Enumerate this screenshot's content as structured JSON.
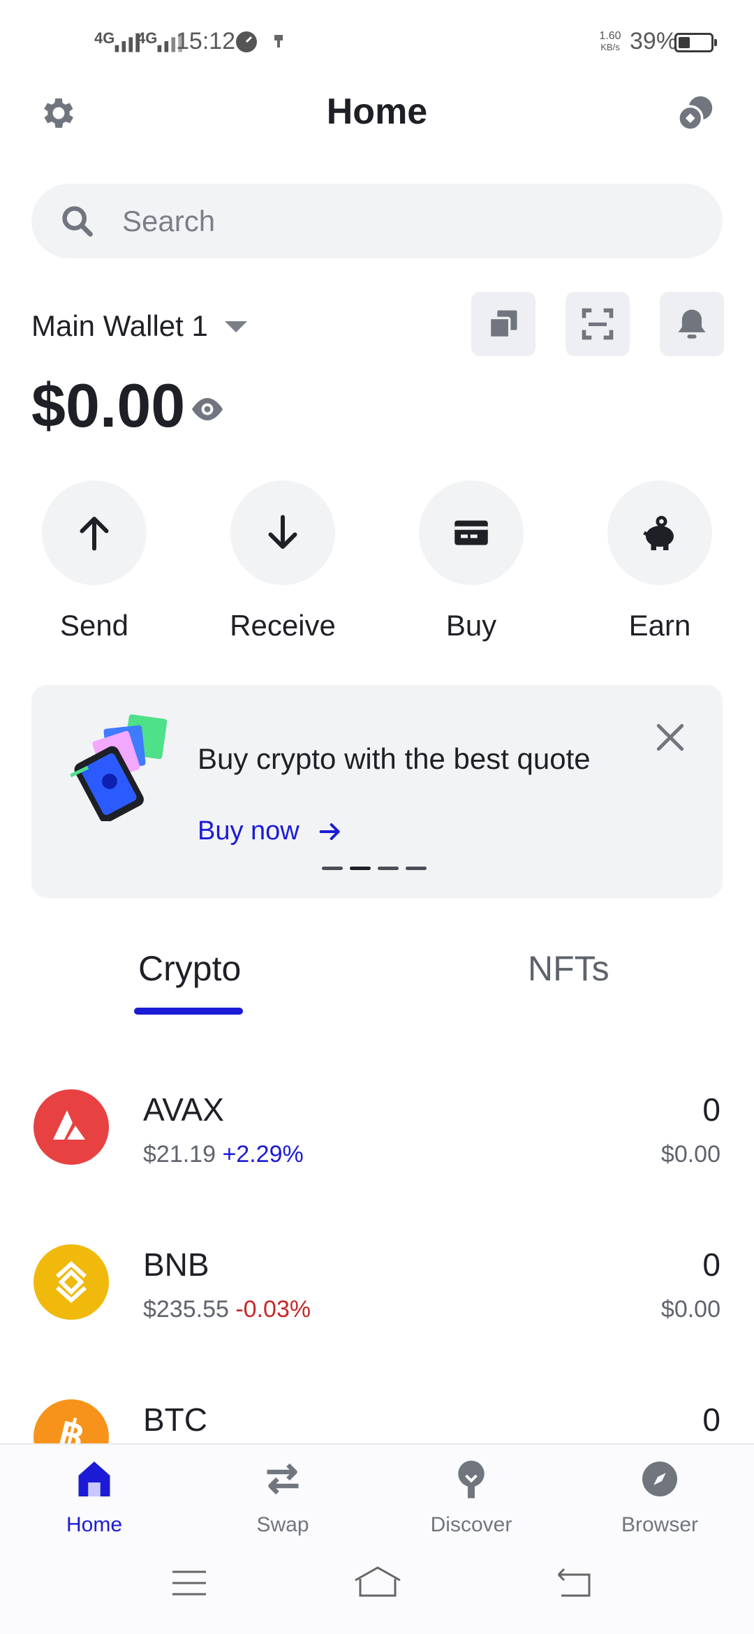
{
  "status_bar": {
    "network_1": "4G",
    "network_2": "4G",
    "time": "15:12",
    "speed_top": "1.60",
    "speed_bottom": "KB/s",
    "battery": "39%"
  },
  "header": {
    "title": "Home",
    "settings_icon": "gear-icon",
    "right_icon": "coins-icon"
  },
  "search": {
    "placeholder": "Search"
  },
  "wallet": {
    "name": "Main Wallet 1",
    "balance": "$0.00",
    "quick_icons": [
      "copy-icon",
      "scan-icon",
      "bell-icon"
    ]
  },
  "actions": [
    {
      "label": "Send",
      "icon": "arrow-up-icon"
    },
    {
      "label": "Receive",
      "icon": "arrow-down-icon"
    },
    {
      "label": "Buy",
      "icon": "card-icon"
    },
    {
      "label": "Earn",
      "icon": "piggy-bank-icon"
    }
  ],
  "banner": {
    "title": "Buy crypto with the best quote",
    "link": "Buy now",
    "slides": 4,
    "active_slide": 2
  },
  "tabs": [
    {
      "label": "Crypto",
      "active": true
    },
    {
      "label": "NFTs",
      "active": false
    }
  ],
  "assets": [
    {
      "symbol": "AVAX",
      "price": "$21.19",
      "change": "+2.29%",
      "change_color": "#1b1bd6",
      "amount": "0",
      "value": "$0.00",
      "color": "#e84142"
    },
    {
      "symbol": "BNB",
      "price": "$235.55",
      "change": "-0.03%",
      "change_color": "#c62828",
      "amount": "0",
      "value": "$0.00",
      "color": "#f0b90b"
    },
    {
      "symbol": "BTC",
      "amount": "0",
      "color": "#f7931a"
    }
  ],
  "bottom_nav": [
    {
      "label": "Home",
      "active": true
    },
    {
      "label": "Swap",
      "active": false
    },
    {
      "label": "Discover",
      "active": false
    },
    {
      "label": "Browser",
      "active": false
    }
  ],
  "colors": {
    "accent": "#1b1bd6",
    "inactive": "#70757e"
  }
}
